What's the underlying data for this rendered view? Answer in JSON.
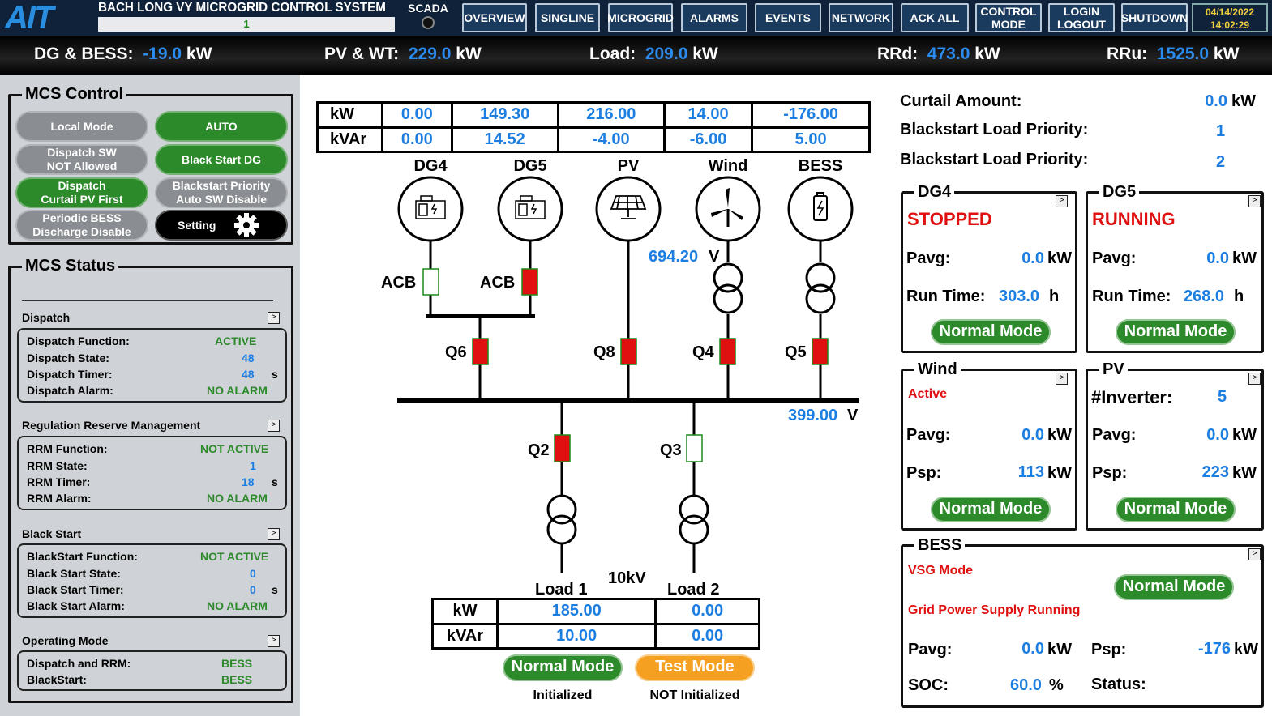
{
  "header": {
    "logo": "AIT",
    "system_title": "BACH LONG VY MICROGRID CONTROL SYSTEM",
    "system_field": "1",
    "scada_label": "SCADA",
    "nav": [
      "OVERVIEW",
      "SINGLINE",
      "MICROGRID",
      "ALARMS",
      "EVENTS",
      "NETWORK",
      "ACK ALL"
    ],
    "control_mode": [
      "CONTROL",
      "MODE"
    ],
    "login_logout": [
      "LOGIN",
      "LOGOUT"
    ],
    "shutdown": "SHUTDOWN",
    "date": "04/14/2022",
    "time": "14:02:29"
  },
  "summary": {
    "dg_bess_label": "DG & BESS:",
    "dg_bess_value": "-19.0",
    "unit": "kW",
    "pv_wt_label": "PV & WT:",
    "pv_wt_value": "229.0",
    "load_label": "Load:",
    "load_value": "209.0",
    "rrd_label": "RRd:",
    "rrd_value": "473.0",
    "rru_label": "RRu:",
    "rru_value": "1525.0"
  },
  "mcs_control": {
    "title": "MCS Control",
    "buttons": {
      "local_mode": "Local Mode",
      "auto": "AUTO",
      "dispatch_sw_1": "Dispatch SW",
      "dispatch_sw_2": "NOT Allowed",
      "black_start_dg": "Black Start DG",
      "dispatch_1": "Dispatch",
      "dispatch_2": "Curtail PV First",
      "bs_priority_1": "Blackstart Priority",
      "bs_priority_2": "Auto SW Disable",
      "periodic_1": "Periodic BESS",
      "periodic_2": "Discharge Disable",
      "setting": "Setting"
    }
  },
  "mcs_status": {
    "title": "MCS Status",
    "dispatch": {
      "header": "Dispatch",
      "function_label": "Dispatch Function:",
      "function_value": "ACTIVE",
      "state_label": "Dispatch State:",
      "state_value": "48",
      "timer_label": "Dispatch Timer:",
      "timer_value": "48",
      "timer_unit": "s",
      "alarm_label": "Dispatch Alarm:",
      "alarm_value": "NO ALARM"
    },
    "rrm": {
      "header": "Regulation Reserve Management",
      "function_label": "RRM Function:",
      "function_value": "NOT ACTIVE",
      "state_label": "RRM State:",
      "state_value": "1",
      "timer_label": "RRM  Timer:",
      "timer_value": "18",
      "timer_unit": "s",
      "alarm_label": "RRM Alarm:",
      "alarm_value": "NO ALARM"
    },
    "black_start": {
      "header": "Black Start",
      "function_label": "BlackStart Function:",
      "function_value": "NOT ACTIVE",
      "state_label": "Black Start State:",
      "state_value": "0",
      "timer_label": "Black Start Timer:",
      "timer_value": "0",
      "timer_unit": "s",
      "alarm_label": "Black Start Alarm:",
      "alarm_value": "NO ALARM"
    },
    "operating_mode": {
      "header": "Operating Mode",
      "dispatch_rrm_label": "Dispatch and RRM:",
      "dispatch_rrm_value": "BESS",
      "blackstart_label": "BlackStart:",
      "blackstart_value": "BESS"
    }
  },
  "singleline": {
    "gen_table": {
      "row_labels": [
        "kW",
        "kVAr"
      ],
      "kw": [
        "0.00",
        "149.30",
        "216.00",
        "14.00",
        "-176.00"
      ],
      "kvar": [
        "0.00",
        "14.52",
        "-4.00",
        "-6.00",
        "5.00"
      ]
    },
    "sources": [
      "DG4",
      "DG5",
      "PV",
      "Wind",
      "BESS"
    ],
    "acb_label": "ACB",
    "breakers": [
      "Q6",
      "Q8",
      "Q4",
      "Q5",
      "Q2",
      "Q3"
    ],
    "bus_voltage_top": "694.20",
    "bus_voltage": "399.00",
    "volt_unit": "V",
    "voltage_level": "10kV",
    "loads": [
      "Load 1",
      "Load 2"
    ],
    "load_table": {
      "row_labels": [
        "kW",
        "kVAr"
      ],
      "kw": [
        "185.00",
        "0.00"
      ],
      "kvar": [
        "10.00",
        "0.00"
      ]
    },
    "load1_mode": "Normal Mode",
    "load2_mode": "Test Mode",
    "load1_init": "Initialized",
    "load2_init": "NOT Initialized"
  },
  "right": {
    "curtail_label": "Curtail Amount:",
    "curtail_value": "0.0",
    "unit_kw": "kW",
    "bs_priority_label_1": "Blackstart Load Priority:",
    "bs_priority_value_1": "1",
    "bs_priority_label_2": "Blackstart Load Priority:",
    "bs_priority_value_2": "2",
    "dg4": {
      "title": "DG4",
      "status": "STOPPED",
      "pavg_label": "Pavg:",
      "pavg_value": "0.0",
      "runtime_label": "Run Time:",
      "runtime_value": "303.0",
      "runtime_unit": "h",
      "mode": "Normal Mode"
    },
    "dg5": {
      "title": "DG5",
      "status": "RUNNING",
      "pavg_label": "Pavg:",
      "pavg_value": "0.0",
      "runtime_label": "Run Time:",
      "runtime_value": "268.0",
      "runtime_unit": "h",
      "mode": "Normal Mode"
    },
    "wind": {
      "title": "Wind",
      "status": "Active",
      "pavg_label": "Pavg:",
      "pavg_value": "0.0",
      "psp_label": "Psp:",
      "psp_value": "113",
      "mode": "Normal Mode"
    },
    "pv": {
      "title": "PV",
      "inverter_label": "#Inverter:",
      "inverter_value": "5",
      "pavg_label": "Pavg:",
      "pavg_value": "0.0",
      "psp_label": "Psp:",
      "psp_value": "223",
      "mode": "Normal Mode"
    },
    "bess": {
      "title": "BESS",
      "vsg_mode": "VSG Mode",
      "mode": "Normal Mode",
      "grid_status": "Grid Power Supply Running",
      "pavg_label": "Pavg:",
      "pavg_value": "0.0",
      "psp_label": "Psp:",
      "psp_value": "-176",
      "soc_label": "SOC:",
      "soc_value": "60.0",
      "soc_unit": "%",
      "status_label": "Status:"
    }
  },
  "colors": {
    "accent_blue": "#1c7ee0",
    "ok_green": "#2c8a2a",
    "alarm_red": "#e01010",
    "test_orange": "#f5a021",
    "breaker_closed": "#e01010"
  }
}
